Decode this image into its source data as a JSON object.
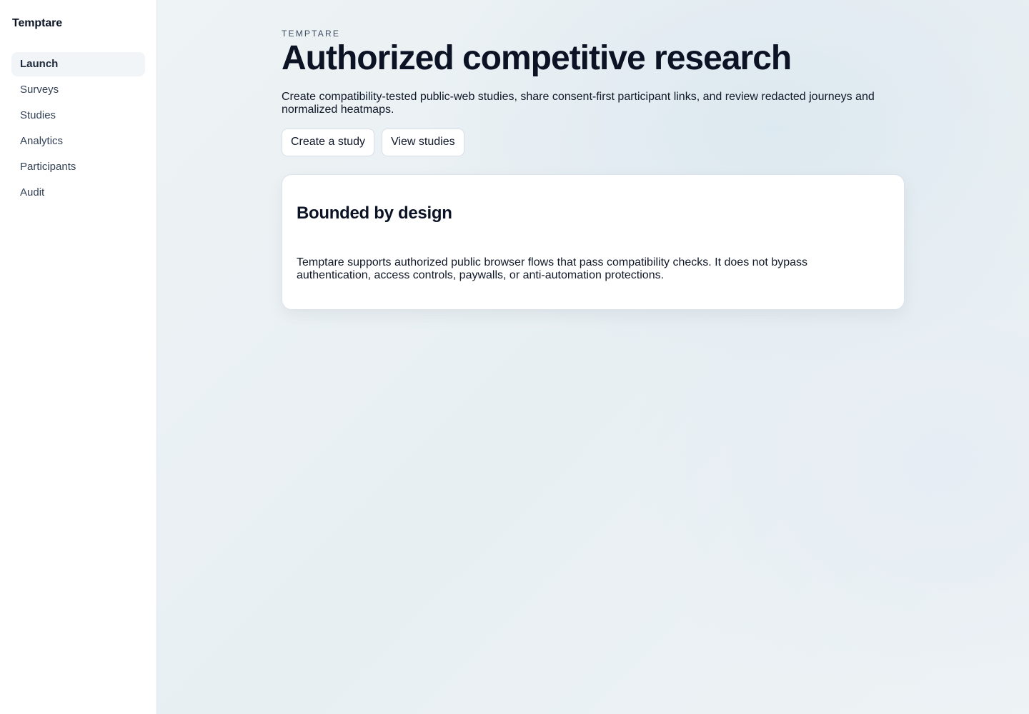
{
  "app": {
    "brand": "Temptare"
  },
  "sidebar": {
    "items": [
      {
        "label": "Launch",
        "active": true
      },
      {
        "label": "Surveys",
        "active": false
      },
      {
        "label": "Studies",
        "active": false
      },
      {
        "label": "Analytics",
        "active": false
      },
      {
        "label": "Participants",
        "active": false
      },
      {
        "label": "Audit",
        "active": false
      }
    ]
  },
  "main": {
    "eyebrow": "TEMPTARE",
    "title": "Authorized competitive research",
    "subtitle": "Create compatibility-tested public-web studies, share consent-first participant links, and review redacted journeys and normalized heatmaps.",
    "actions": {
      "create_label": "Create a study",
      "view_label": "View studies"
    },
    "card": {
      "title": "Bounded by design",
      "body": "Temptare supports authorized public browser flows that pass compatibility checks. It does not bypass authentication, access controls, paywalls, or anti-automation protections."
    }
  },
  "colors": {
    "text_primary": "#0b1324",
    "sidebar_active_bg": "#f1f5f8",
    "border": "#dfe5ec",
    "background": "#e8eff3"
  }
}
